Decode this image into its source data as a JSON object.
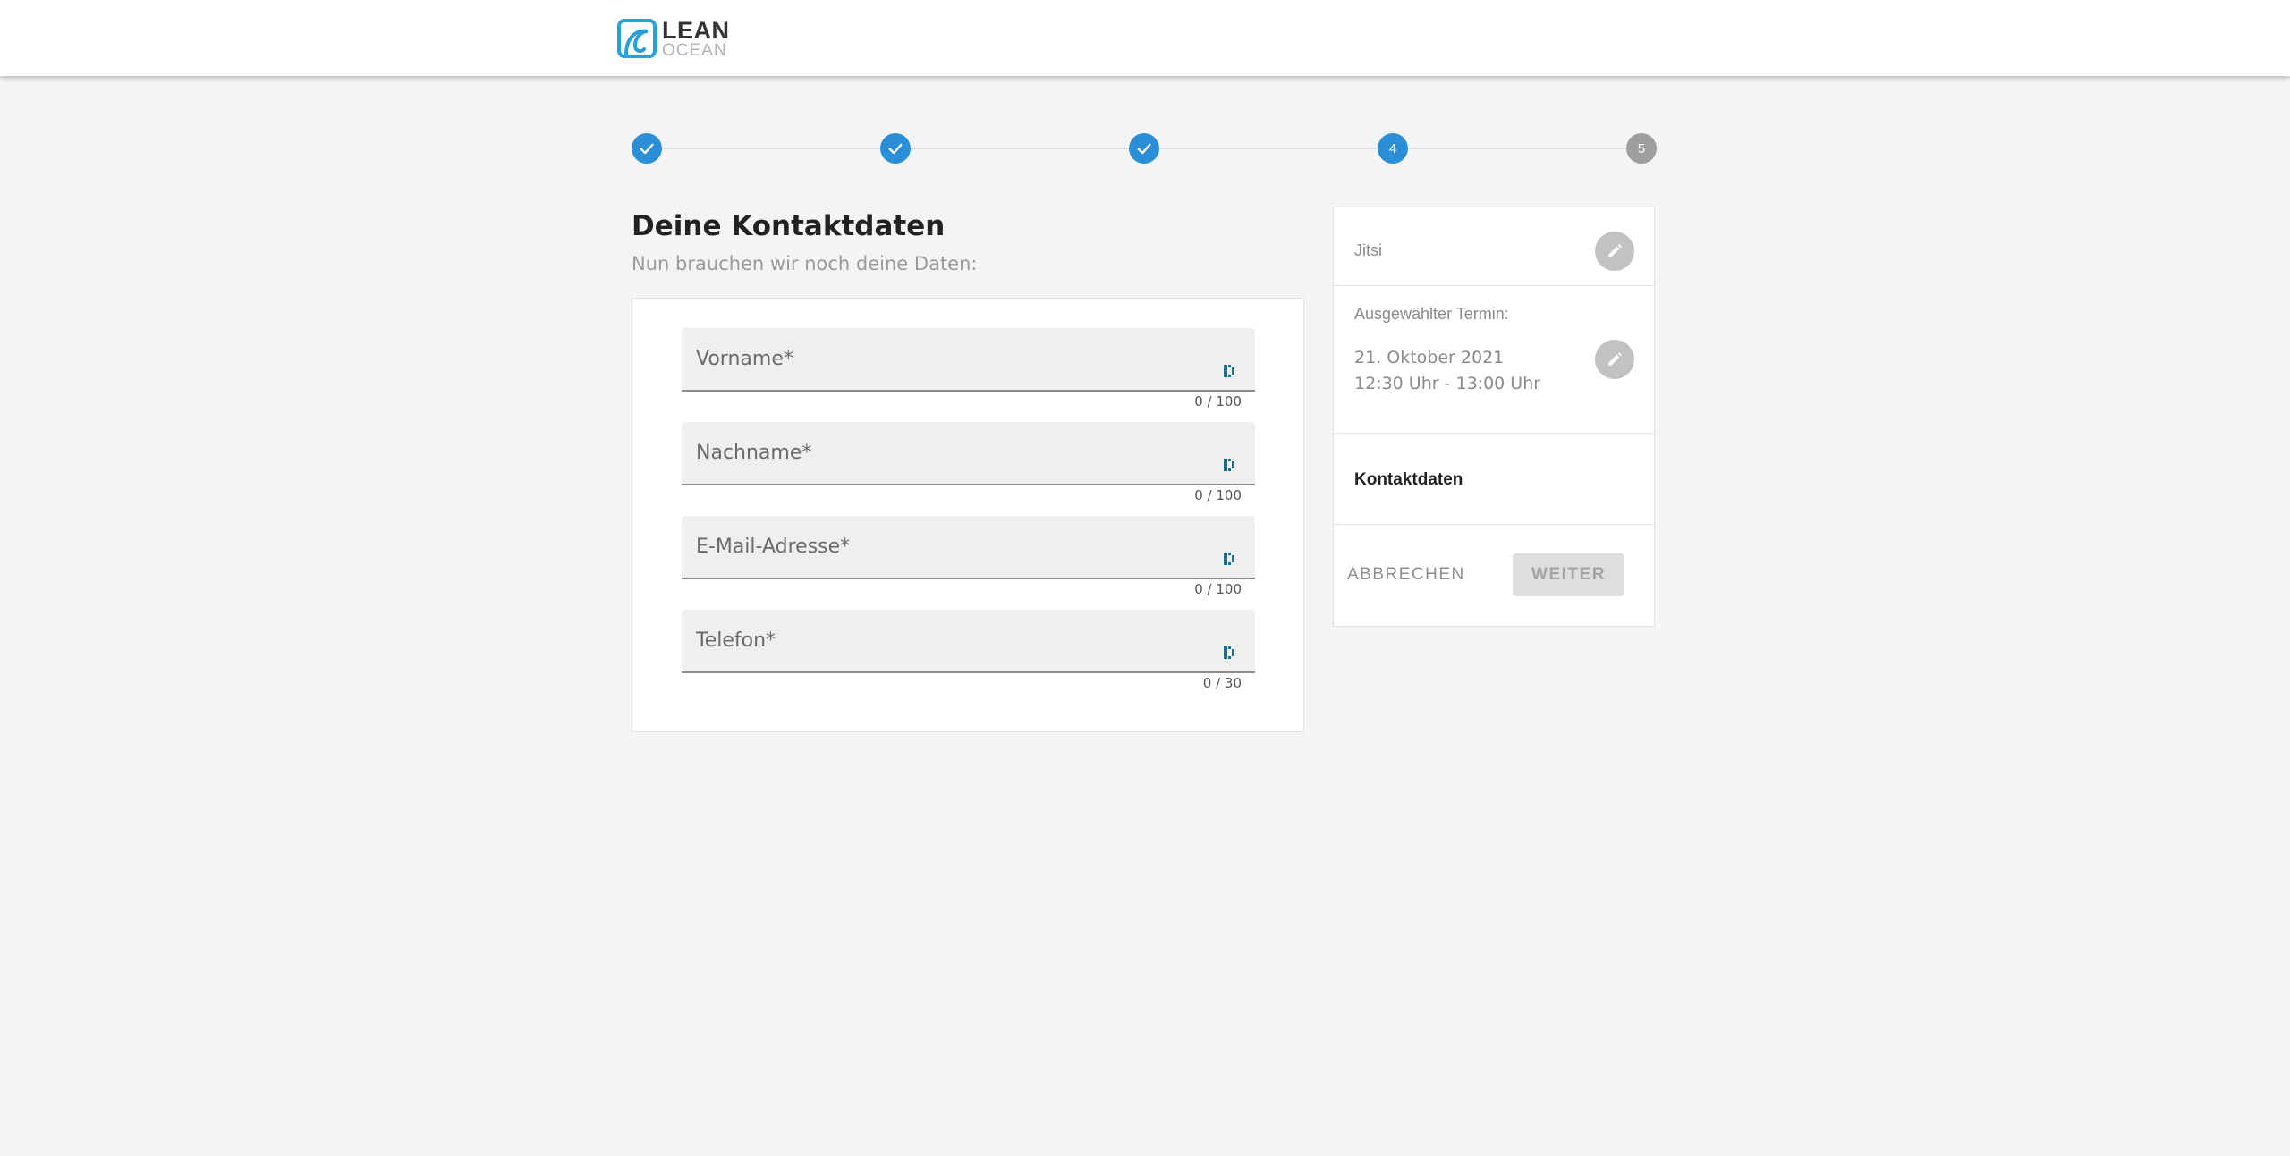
{
  "brand": {
    "line1": "LEAN",
    "line2": "OCEAN",
    "color": "#2a9fd8"
  },
  "stepper": {
    "steps": [
      {
        "state": "done",
        "label": ""
      },
      {
        "state": "done",
        "label": ""
      },
      {
        "state": "done",
        "label": ""
      },
      {
        "state": "active",
        "label": "4"
      },
      {
        "state": "pending",
        "label": "5"
      }
    ],
    "accent": "#2a8fd6"
  },
  "form": {
    "title": "Deine Kontaktdaten",
    "subtitle": "Nun brauchen wir noch deine Daten:",
    "fields": [
      {
        "label": "Vorname*",
        "value": "",
        "counter": "0 / 100"
      },
      {
        "label": "Nachname*",
        "value": "",
        "counter": "0 / 100"
      },
      {
        "label": "E-Mail-Adresse*",
        "value": "",
        "counter": "0 / 100"
      },
      {
        "label": "Telefon*",
        "value": "",
        "counter": "0 / 30"
      }
    ]
  },
  "summary": {
    "tool": "Jitsi",
    "termin_title": "Ausgewählter Termin:",
    "termin_date": "21. Oktober 2021",
    "termin_time": "12:30 Uhr - 13:00 Uhr",
    "current_section": "Kontaktdaten",
    "cancel_label": "ABBRECHEN",
    "next_label": "WEITER"
  }
}
